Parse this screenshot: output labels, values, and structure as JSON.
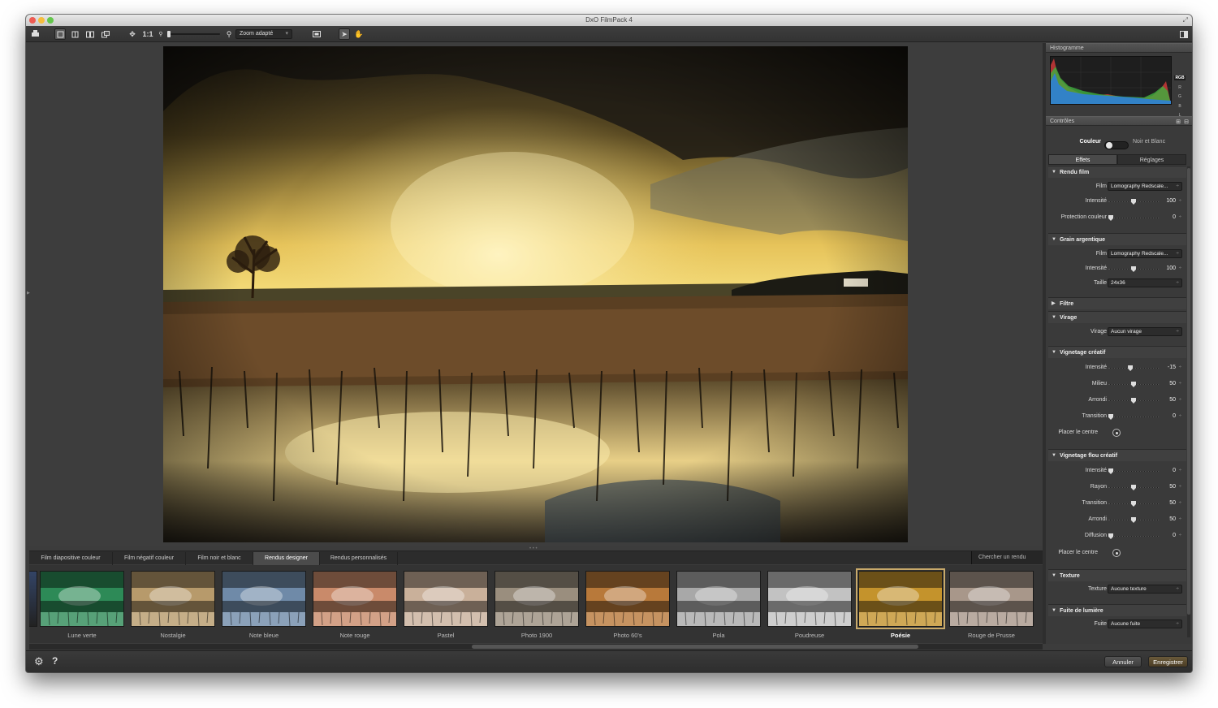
{
  "window": {
    "title": "DxO FilmPack 4"
  },
  "toolbar": {
    "zoom_ratio": "1:1",
    "zoom_select": "Zoom adapté"
  },
  "histogram": {
    "title": "Histogramme",
    "channels": [
      "RGB",
      "R",
      "G",
      "B",
      "L"
    ]
  },
  "controls": {
    "title": "Contrôles",
    "mode_left": "Couleur",
    "mode_right": "Noir et Blanc",
    "tabs": [
      "Effets",
      "Réglages"
    ],
    "rendu_film": {
      "title": "Rendu film",
      "film_label": "Film",
      "film_value": "Lomography Redscale...",
      "intensite_label": "Intensité",
      "intensite_value": "100",
      "intensite_level": 0.5,
      "protection_label": "Protection couleur",
      "protection_value": "0",
      "protection_level": 0
    },
    "grain": {
      "title": "Grain argentique",
      "film_label": "Film",
      "film_value": "Lomography Redscale...",
      "intensite_label": "Intensité",
      "intensite_value": "100",
      "intensite_level": 0.5,
      "taille_label": "Taille",
      "taille_value": "24x36"
    },
    "filtre": {
      "title": "Filtre"
    },
    "virage": {
      "title": "Virage",
      "label": "Virage",
      "value": "Aucun virage"
    },
    "vignetage": {
      "title": "Vignetage créatif",
      "intensite_label": "Intensité",
      "intensite_value": "-15",
      "intensite_level": 0.43,
      "milieu_label": "Milieu",
      "milieu_value": "50",
      "milieu_level": 0.5,
      "arrondi_label": "Arrondi",
      "arrondi_value": "50",
      "arrondi_level": 0.5,
      "transition_label": "Transition",
      "transition_value": "0",
      "transition_level": 0,
      "center_label": "Placer le centre"
    },
    "vignetage_flou": {
      "title": "Vignetage flou créatif",
      "intensite_label": "Intensité",
      "intensite_value": "0",
      "intensite_level": 0,
      "rayon_label": "Rayon",
      "rayon_value": "50",
      "rayon_level": 0.5,
      "transition_label": "Transition",
      "transition_value": "50",
      "transition_level": 0.5,
      "arrondi_label": "Arrondi",
      "arrondi_value": "50",
      "arrondi_level": 0.5,
      "diffusion_label": "Diffusion",
      "diffusion_value": "0",
      "diffusion_level": 0,
      "center_label": "Placer le centre"
    },
    "texture": {
      "title": "Texture",
      "label": "Texture",
      "value": "Aucune texture"
    },
    "fuite": {
      "title": "Fuite de lumière",
      "label": "Fuite",
      "value": "Aucune fuite"
    }
  },
  "bottom_tabs": {
    "items": [
      "Film diapositive couleur",
      "Film négatif couleur",
      "Film noir et blanc",
      "Rendus designer",
      "Rendus personnalisés"
    ],
    "active": "Rendus designer",
    "search": "Chercher un rendu"
  },
  "presets": {
    "items": [
      "Lune verte",
      "Nostalgie",
      "Note bleue",
      "Note rouge",
      "Pastel",
      "Photo 1900",
      "Photo 60's",
      "Pola",
      "Poudreuse",
      "Poésie",
      "Rouge de Prusse"
    ],
    "selected": "Poésie"
  },
  "footer": {
    "cancel": "Annuler",
    "save": "Enregistrer"
  },
  "colors": {
    "accent": "#c8a96a",
    "panel": "#3a3a3a",
    "viewer": "#3d3d3d"
  }
}
